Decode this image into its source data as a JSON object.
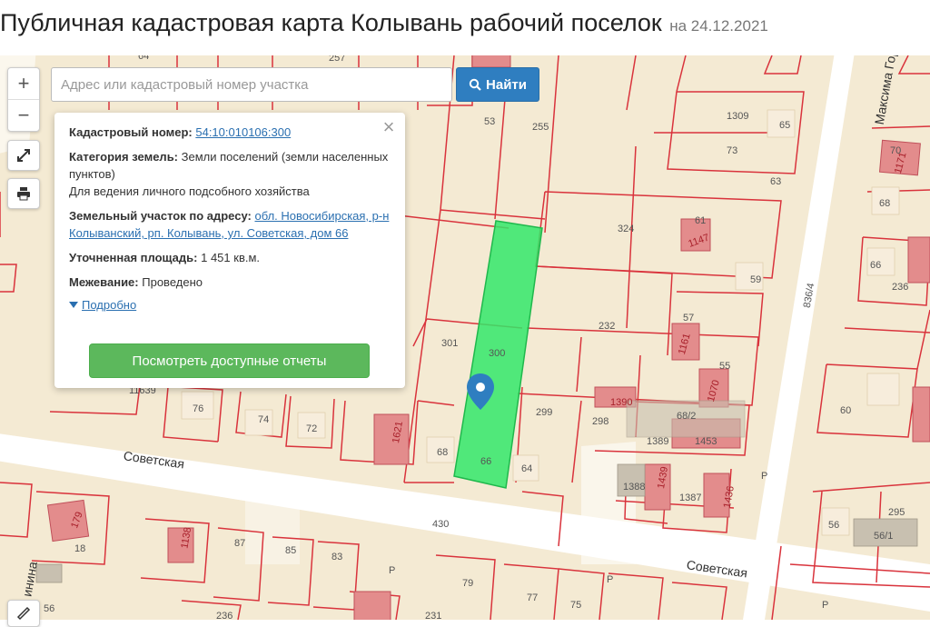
{
  "page": {
    "title": "Публичная кадастровая карта Колывань рабочий поселок",
    "date": "на 24.12.2021"
  },
  "colors": {
    "map_background": "#f4ead3",
    "parcel_border": "#d9333c",
    "highlighted_parcel": "#33e86a",
    "building_fill": "#e38c8c",
    "road": "#ffffff",
    "button_primary": "#2f7ec0",
    "button_success": "#5cb85c",
    "marker": "#2f7ec0"
  },
  "controls": {
    "zoom_in": "+",
    "zoom_out": "−",
    "icons": [
      "fullscreen-icon",
      "print-icon",
      "ruler-icon"
    ]
  },
  "search": {
    "placeholder": "Адрес или кадастровый номер участка",
    "value": "",
    "button": "Найти",
    "button_icon": "search-icon"
  },
  "info": {
    "close": "×",
    "cadastral_label": "Кадастровый номер:",
    "cadastral_value": "54:10:010106:300",
    "category_label": "Категория земель:",
    "category_value": "Земли поселений (земли населенных пунктов)",
    "usage": "Для ведения личного подсобного хозяйства",
    "address_label": "Земельный участок по адресу:",
    "address_value": "обл. Новосибирская, р-н Колыванский, рп. Колывань, ул. Советская, дом 66",
    "area_label": "Уточненная площадь:",
    "area_value": "1 451 кв.м.",
    "survey_label": "Межевание:",
    "survey_value": "Проведено",
    "more": "Подробно",
    "reports_button": "Посмотреть доступные отчеты"
  },
  "map": {
    "streets": [
      "Советская",
      "Советская",
      "Максима Горь",
      "инина"
    ],
    "labels": [
      "64",
      "257",
      "53",
      "255",
      "1309",
      "65",
      "73",
      "63",
      "70",
      "1171",
      "68",
      "61",
      "1147",
      "324",
      "66",
      "236",
      "59",
      "836/4",
      "57",
      "1161",
      "232",
      "301",
      "300",
      "2",
      "55",
      "1070",
      "1390",
      "298",
      "299",
      "68/2",
      "1389",
      "1453",
      "60",
      "76",
      "74",
      "72",
      "1621",
      "68",
      "66",
      "64",
      "1439",
      "1388",
      "1387",
      "1436",
      "295",
      "56",
      "56/1",
      "179",
      "18",
      "1138",
      "87",
      "85",
      "83",
      "430",
      "79",
      "77",
      "75",
      "231",
      "236",
      "56",
      "11639",
      "P",
      "P",
      "P",
      "P"
    ]
  }
}
